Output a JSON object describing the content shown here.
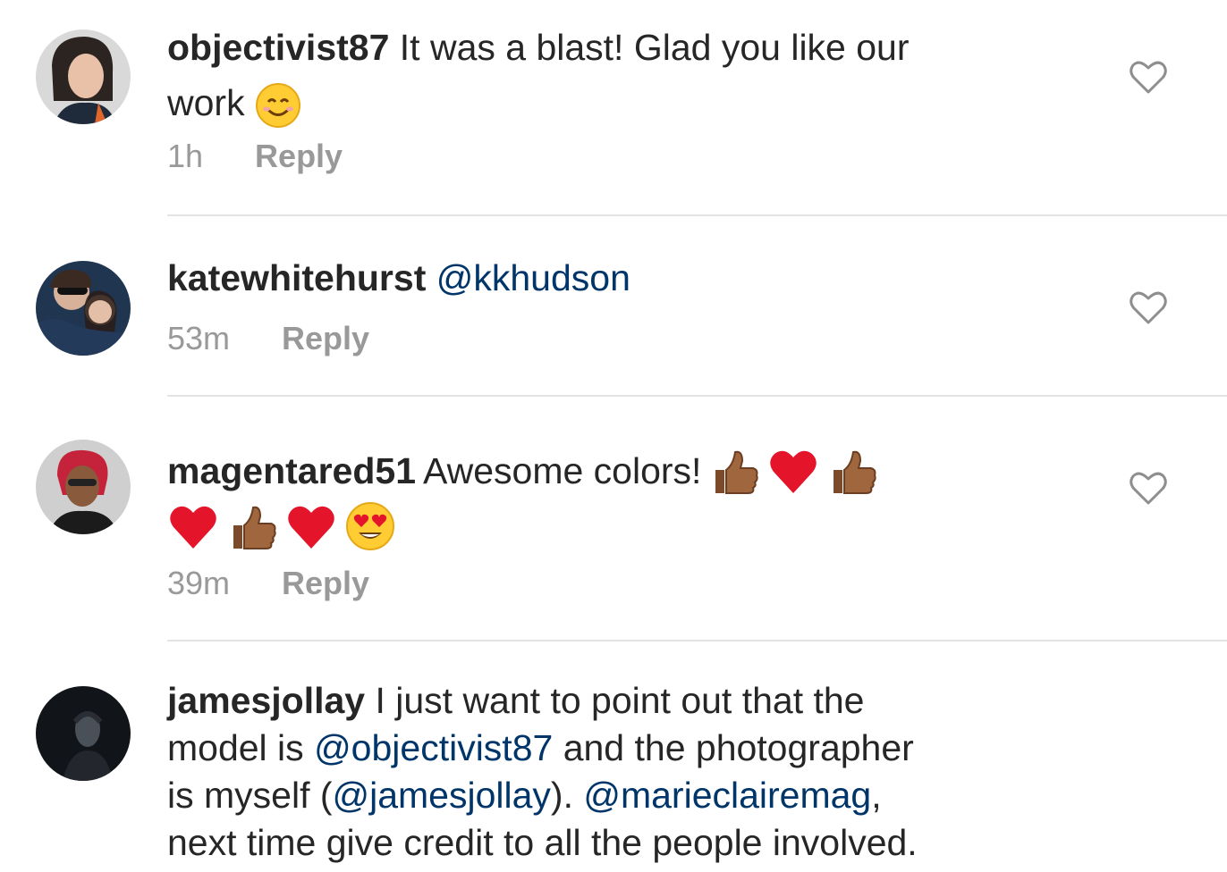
{
  "comments": [
    {
      "username": "objectivist87",
      "text_part1": " It was a blast! Glad you like our",
      "text_part2": "work",
      "time": "1h",
      "reply_label": "Reply"
    },
    {
      "username": "katewhitehurst",
      "mention": "@kkhudson",
      "time": "53m",
      "reply_label": "Reply"
    },
    {
      "username": "magentared51",
      "text": " Awesome colors!",
      "emojis": [
        "thumbs-up",
        "red-heart",
        "thumbs-up",
        "red-heart",
        "thumbs-up",
        "red-heart",
        "heart-eyes"
      ],
      "time": "39m",
      "reply_label": "Reply"
    },
    {
      "username": "jamesjollay",
      "text_a": " I just want to point out that the",
      "text_b": "model is ",
      "mention1": "@objectivist87",
      "text_c": " and the photographer",
      "text_d": "is myself (",
      "mention2": "@jamesjollay",
      "text_e": "). ",
      "mention3": "@marieclairemag",
      "text_f": ",",
      "text_g": "next time give credit to all the people involved."
    }
  ],
  "colors": {
    "username": "#262626",
    "mention": "#003569",
    "meta": "#999999",
    "divider": "#e3e3e3"
  }
}
